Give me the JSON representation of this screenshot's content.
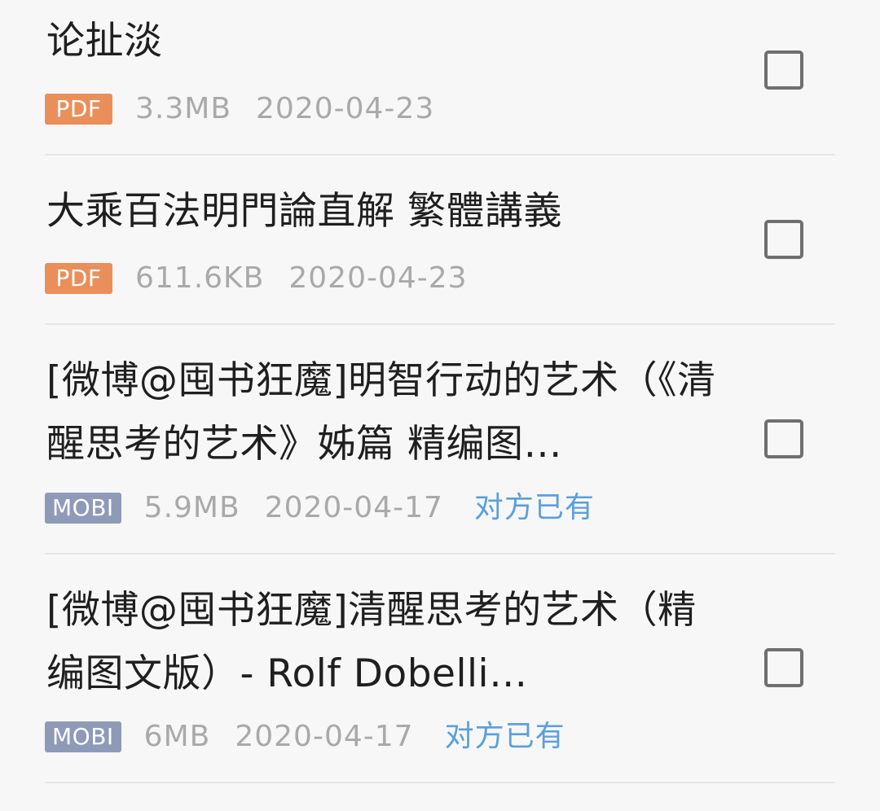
{
  "files": [
    {
      "title": "论扯淡",
      "type": "PDF",
      "size": "3.3MB",
      "date": "2020-04-23",
      "status": "",
      "badge_color": "#eb8f5a"
    },
    {
      "title": "大乘百法明門論直解 繁體講義",
      "type": "PDF",
      "size": "611.6KB",
      "date": "2020-04-23",
      "status": "",
      "badge_color": "#eb8f5a"
    },
    {
      "title": "[微博@囤书狂魔]明智行动的艺术（《清醒思考的艺术》姊篇 精编图…",
      "type": "MOBI",
      "size": "5.9MB",
      "date": "2020-04-17",
      "status": "对方已有",
      "badge_color": "#8e9ab8"
    },
    {
      "title": "[微博@囤书狂魔]清醒思考的艺术（精编图文版）- Rolf Dobelli…",
      "type": "MOBI",
      "size": "6MB",
      "date": "2020-04-17",
      "status": "对方已有",
      "badge_color": "#8e9ab8"
    }
  ]
}
